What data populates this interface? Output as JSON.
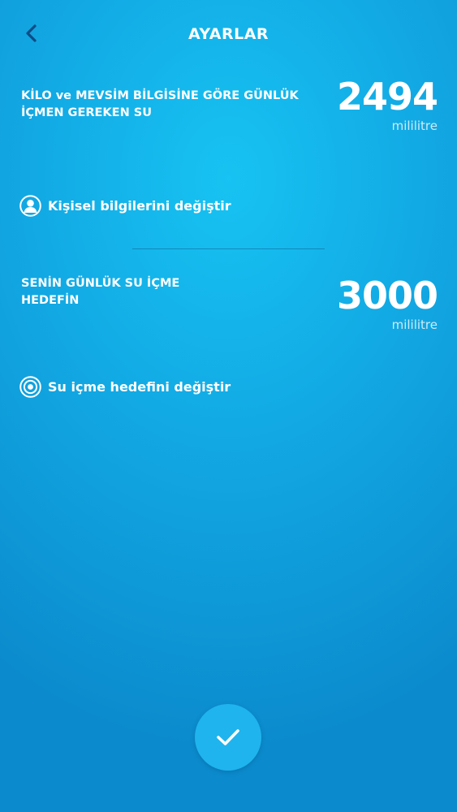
{
  "header": {
    "title": "AYARLAR",
    "back_icon": "chevron-left-icon"
  },
  "recommended": {
    "label_line1": "KİLO ve MEVSİM BİLGİSİNE GÖRE GÜNLÜK",
    "label_line2": "İÇMEN GEREKEN SU",
    "value": "2494",
    "unit": "mililitre"
  },
  "personal_info_link": {
    "icon": "user-icon",
    "label": "Kişisel bilgilerini değiştir"
  },
  "goal": {
    "label_line1": "SENİN GÜNLÜK SU İÇME",
    "label_line2": "HEDEFİN",
    "value": "3000",
    "unit": "mililitre"
  },
  "goal_link": {
    "icon": "target-icon",
    "label": "Su içme hedefini değiştir"
  },
  "confirm": {
    "icon": "checkmark-icon"
  },
  "colors": {
    "background_light": "#17c3f2",
    "background_dark": "#0b8bcd",
    "back_arrow": "#0f4c86",
    "confirm_button": "#1fb4ee",
    "unit_text": "#cdebf7"
  }
}
